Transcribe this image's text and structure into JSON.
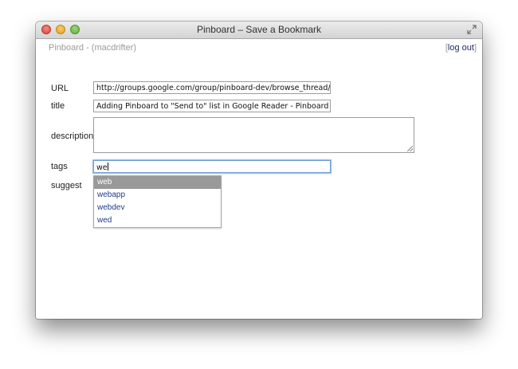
{
  "window": {
    "title": "Pinboard – Save a Bookmark"
  },
  "header": {
    "brand": "Pinboard - (macdrifter)",
    "logout_open": "[",
    "logout_label": "log out",
    "logout_close": "]"
  },
  "form": {
    "url_label": "URL",
    "url_value": "http://groups.google.com/group/pinboard-dev/browse_thread/threa",
    "title_label": "title",
    "title_value": "Adding Pinboard to \"Send to\" list in Google Reader - Pinboard | Goog",
    "description_label": "description",
    "description_value": "",
    "tags_label": "tags",
    "tags_value": "we",
    "suggest_label": "suggest"
  },
  "autocomplete": {
    "items": [
      "web",
      "webapp",
      "webdev",
      "wed"
    ],
    "selected_index": 0
  },
  "colors": {
    "selected_bg": "#999999",
    "link": "#1f3d8a",
    "focus_ring": "#7aaee3"
  }
}
